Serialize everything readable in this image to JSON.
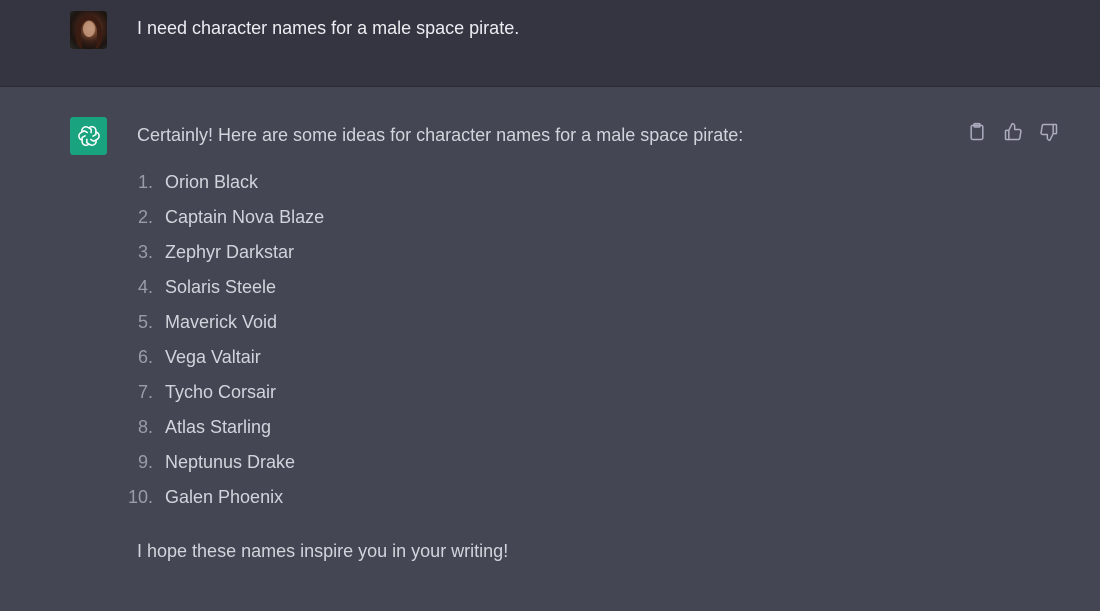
{
  "conversation": {
    "user_message": {
      "avatar": "user-avatar-photo",
      "text": "I need character names for a male space pirate."
    },
    "assistant_message": {
      "avatar": "openai-logo-icon",
      "intro": "Certainly! Here are some ideas for character names for a male space pirate:",
      "names": [
        {
          "number": "1.",
          "name": "Orion Black"
        },
        {
          "number": "2.",
          "name": "Captain Nova Blaze"
        },
        {
          "number": "3.",
          "name": "Zephyr Darkstar"
        },
        {
          "number": "4.",
          "name": "Solaris Steele"
        },
        {
          "number": "5.",
          "name": "Maverick Void"
        },
        {
          "number": "6.",
          "name": "Vega Valtair"
        },
        {
          "number": "7.",
          "name": "Tycho Corsair"
        },
        {
          "number": "8.",
          "name": "Atlas Starling"
        },
        {
          "number": "9.",
          "name": "Neptunus Drake"
        },
        {
          "number": "10.",
          "name": "Galen Phoenix"
        }
      ],
      "closing": "I hope these names inspire you in your writing!",
      "actions": [
        {
          "icon": "clipboard-icon",
          "label": "Copy"
        },
        {
          "icon": "thumbs-up-icon",
          "label": "Good response"
        },
        {
          "icon": "thumbs-down-icon",
          "label": "Bad response"
        }
      ]
    }
  },
  "colors": {
    "user_bg": "#343541",
    "assistant_bg": "#444654",
    "gpt_avatar_bg": "#19a37f",
    "text_primary": "#ececf1",
    "text_secondary": "#d1d5db"
  }
}
